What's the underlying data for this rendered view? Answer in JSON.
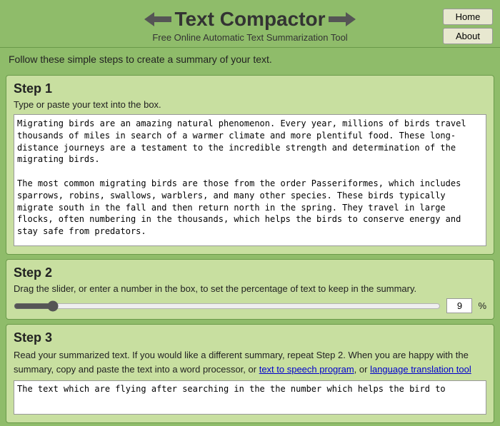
{
  "header": {
    "title": "Text Compactor",
    "subtitle": "Free Online Automatic Text Summarization Tool",
    "nav": {
      "home_label": "Home",
      "about_label": "About"
    }
  },
  "intro": {
    "text": "Follow these simple steps to create a summary of your text."
  },
  "step1": {
    "title": "Step 1",
    "description": "Type or paste your text into the box.",
    "textarea_content": "Migrating birds are an amazing natural phenomenon. Every year, millions of birds travel thousands of miles in search of a warmer climate and more plentiful food. These long-distance journeys are a testament to the incredible strength and determination of the migrating birds.\n\nThe most common migrating birds are those from the order Passeriformes, which includes sparrows, robins, swallows, warblers, and many other species. These birds typically migrate south in the fall and then return north in the spring. They travel in large flocks, often numbering in the thousands, which helps the birds to conserve energy and stay safe from predators.\n\nIn addition to the birds from the Passeriformes order, some other species of birds also migrate. Geese, ducks, and swans are among the most well-known migratory waterfowl. They fly in large V-shaped formations, which help them to utilize the air currents more efficiently. Other birds that migrate include raptors such as eagles and hawks, as well as seabirds and shorebirds.\n\nThe exact motivations behind bird migration still remain a mystery. In some cases, the birds are"
  },
  "step2": {
    "title": "Step 2",
    "description": "Drag the slider, or enter a number in the box, to set the percentage of text to keep in the summary.",
    "slider_value": 9,
    "slider_min": 1,
    "slider_max": 100,
    "percent_symbol": "%"
  },
  "step3": {
    "title": "Step 3",
    "description_start": "Read your summarized text. If you would like a different summary, repeat Step 2. When you are happy with the summary, copy and paste the text into a word processor, or ",
    "link1_text": "text to speech program",
    "link1_href": "#",
    "description_mid": ", or ",
    "link2_text": "language translation tool",
    "link2_href": "#",
    "output_text": "The text which are flying after searching in the the number which helps the bird to"
  }
}
